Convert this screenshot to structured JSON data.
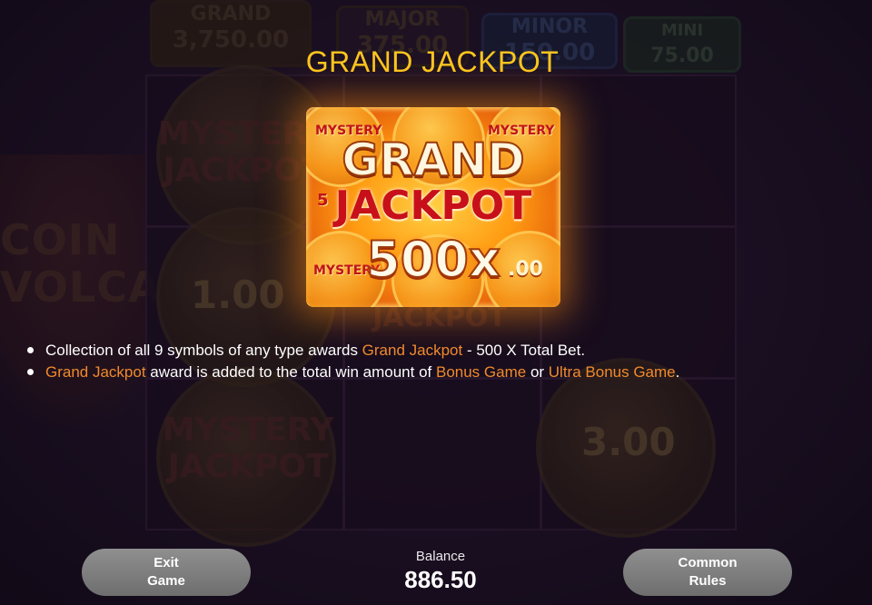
{
  "background": {
    "jackpots": [
      {
        "name": "GRAND",
        "value": "3,750.00"
      },
      {
        "name": "MAJOR",
        "value": "375.00"
      },
      {
        "name": "MINOR",
        "value": "150.00"
      },
      {
        "name": "MINI",
        "value": "75.00"
      }
    ],
    "side_title": "COIN VOLCANO",
    "reel_symbols": {
      "mystery_top": "MYSTERY JACKPOT",
      "mystery_bottom": "MYSTERY JACKPOT",
      "coin_left": "1.00",
      "coin_right": "3.00",
      "jackpot_fragment": "JACKPOT"
    }
  },
  "rules": {
    "title": "GRAND JACKPOT",
    "badge": {
      "line1": "GRAND",
      "line2": "JACKPOT",
      "multiplier": "500x",
      "mini_mystery": "MYSTERY",
      "mini_jackpot": "JACKPOT",
      "mini_value": ".00",
      "mini_digit": "5"
    },
    "bullets": [
      {
        "text_before": "Collection of all 9 symbols of any type awards ",
        "highlight1": "Grand Jackpot",
        "text_after": " - 500 X Total Bet."
      },
      {
        "highlight1": "Grand Jackpot",
        "text_mid1": " award is added to the total win amount of ",
        "highlight2": "Bonus Game",
        "text_mid2": " or ",
        "highlight3": "Ultra Bonus Game",
        "text_end": "."
      }
    ]
  },
  "footer": {
    "exit_label": "Exit\nGame",
    "balance_label": "Balance",
    "balance_value": "886.50",
    "rules_label": "Common\nRules"
  },
  "colors": {
    "title": "#ffc61e",
    "highlight": "#f08a2c",
    "button": "#7f7f7f"
  }
}
